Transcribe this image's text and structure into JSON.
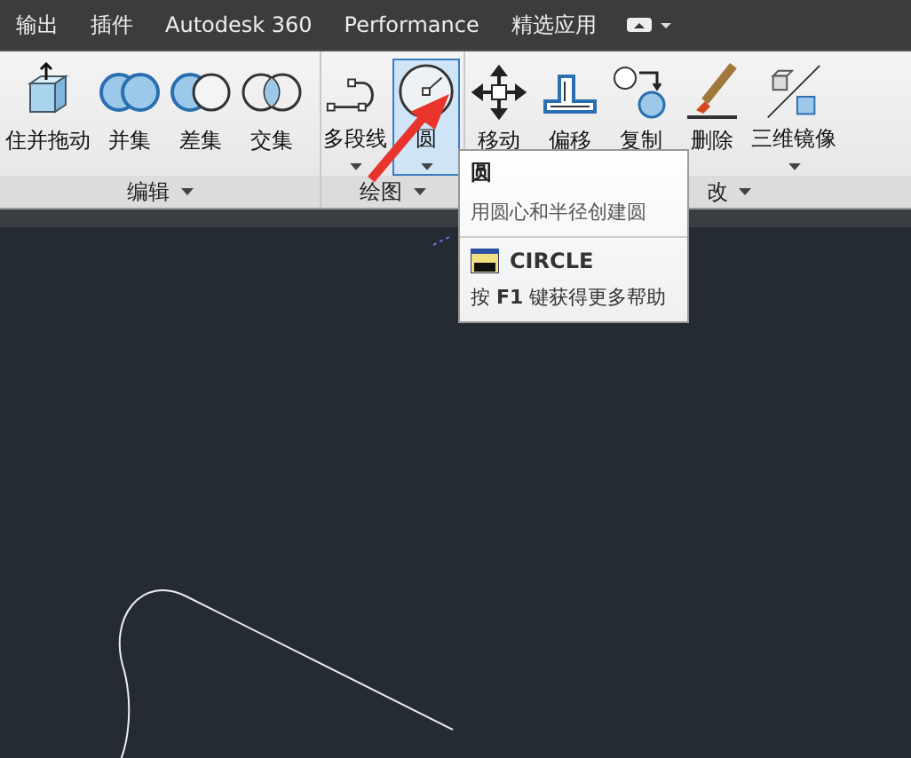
{
  "tabs": [
    {
      "label": "输出",
      "selected": false
    },
    {
      "label": "插件",
      "selected": false
    },
    {
      "label": "Autodesk 360",
      "selected": false
    },
    {
      "label": "Performance",
      "selected": false
    },
    {
      "label": "精选应用",
      "selected": false
    }
  ],
  "panels": [
    {
      "label": "编辑",
      "tools": [
        {
          "label": "住并拖动",
          "kind": "push",
          "caret": false,
          "selected": false
        },
        {
          "label": "并集",
          "kind": "union",
          "caret": false,
          "selected": false
        },
        {
          "label": "差集",
          "kind": "subtract",
          "caret": false,
          "selected": false
        },
        {
          "label": "交集",
          "kind": "intersect",
          "caret": false,
          "selected": false
        }
      ]
    },
    {
      "label": "绘图",
      "tools": [
        {
          "label": "多段线",
          "kind": "polyline",
          "caret": true,
          "selected": false
        },
        {
          "label": "圆",
          "kind": "circle",
          "caret": true,
          "selected": true
        }
      ]
    },
    {
      "label": "改",
      "tools": [
        {
          "label": "移动",
          "kind": "move",
          "caret": false,
          "selected": false
        },
        {
          "label": "偏移",
          "kind": "offset",
          "caret": false,
          "selected": false
        },
        {
          "label": "复制",
          "kind": "copy",
          "caret": false,
          "selected": false
        },
        {
          "label": "删除",
          "kind": "erase",
          "caret": false,
          "selected": false
        },
        {
          "label": "三维镜像",
          "kind": "mirror",
          "caret": true,
          "selected": false
        }
      ]
    }
  ],
  "tooltip": {
    "title": "圆",
    "description": "用圆心和半径创建圆",
    "command": "CIRCLE",
    "help": "按 **F1** 键获得更多帮助"
  }
}
